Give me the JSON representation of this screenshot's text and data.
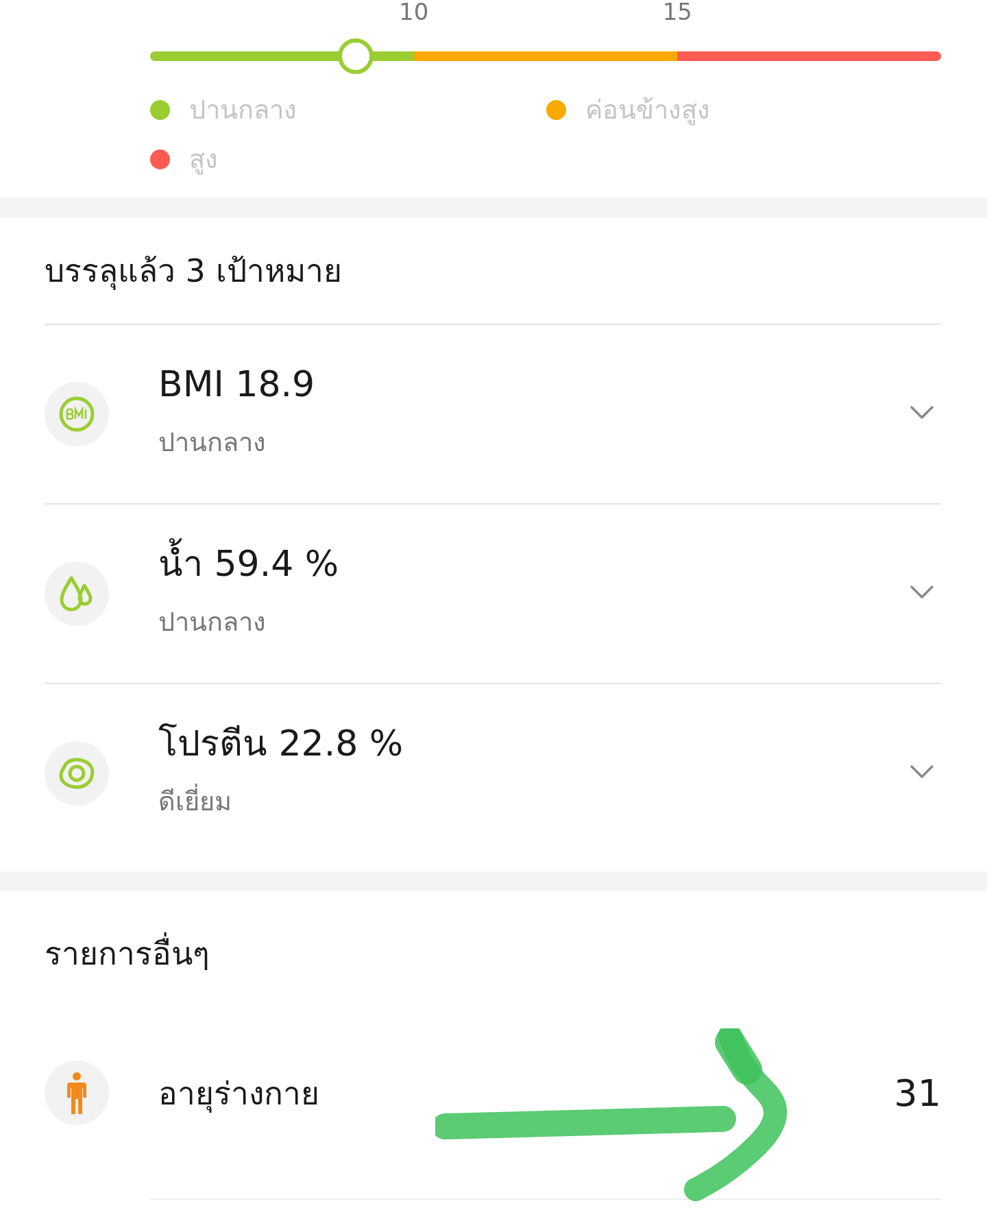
{
  "scale": {
    "ticks": [
      "10",
      "15"
    ],
    "level": 0.26,
    "legend": [
      {
        "label": "ปานกลาง",
        "color": "#9acd32"
      },
      {
        "label": "ค่อนข้างสูง",
        "color": "#f9a900"
      },
      {
        "label": "สูง",
        "color": "#fe5b52"
      }
    ]
  },
  "goals": {
    "title": "บรรลุแล้ว 3 เป้าหมาย",
    "items": [
      {
        "kind": "bmi",
        "title": "BMI 18.9",
        "status": "ปานกลาง"
      },
      {
        "kind": "water",
        "title": "น้ำ 59.4 %",
        "status": "ปานกลาง"
      },
      {
        "kind": "protein",
        "title": "โปรตีน 22.8 %",
        "status": "ดีเยี่ยม"
      }
    ]
  },
  "others": {
    "title": "รายการอื่นๆ",
    "items": [
      {
        "kind": "body-age",
        "label": "อายุร่างกาย",
        "value": "31"
      }
    ]
  }
}
